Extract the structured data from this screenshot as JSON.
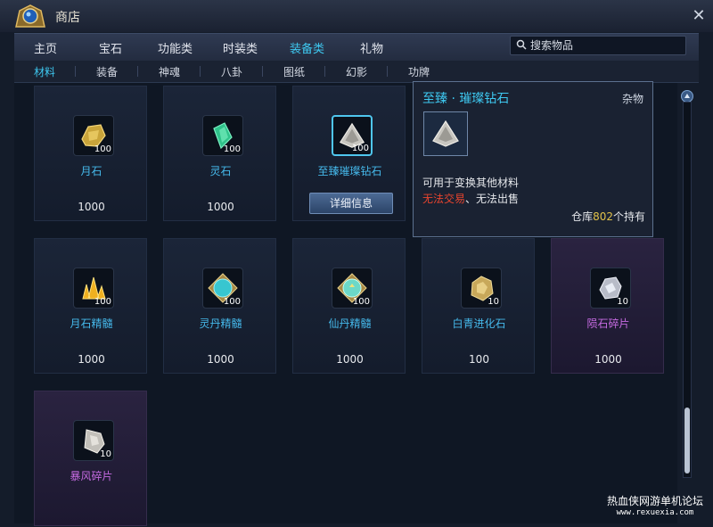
{
  "window": {
    "title": "商店"
  },
  "nav": {
    "tabs": [
      {
        "label": "主页"
      },
      {
        "label": "宝石"
      },
      {
        "label": "功能类"
      },
      {
        "label": "时装类"
      },
      {
        "label": "装备类"
      },
      {
        "label": "礼物"
      }
    ],
    "active_index": 4
  },
  "search": {
    "placeholder": "搜索物品"
  },
  "subnav": {
    "tabs": [
      {
        "label": "材料"
      },
      {
        "label": "装备"
      },
      {
        "label": "神魂"
      },
      {
        "label": "八卦"
      },
      {
        "label": "图纸"
      },
      {
        "label": "幻影"
      },
      {
        "label": "功牌"
      }
    ],
    "active_index": 0
  },
  "items": [
    {
      "name": "月石",
      "qty": "100",
      "price": "1000",
      "icon": "moonstone-icon"
    },
    {
      "name": "灵石",
      "qty": "100",
      "price": "1000",
      "icon": "spirit-stone-icon"
    },
    {
      "name": "至臻璀璨钻石",
      "qty": "100",
      "price": "",
      "icon": "diamond-icon",
      "detail_label": "详细信息"
    },
    {
      "name": "月石精髓",
      "qty": "100",
      "price": "1000",
      "icon": "moonstone-essence-icon"
    },
    {
      "name": "灵丹精髓",
      "qty": "100",
      "price": "1000",
      "icon": "elixir-essence-icon"
    },
    {
      "name": "仙丹精髓",
      "qty": "100",
      "price": "1000",
      "icon": "immortal-elixir-icon"
    },
    {
      "name": "白青进化石",
      "qty": "10",
      "price": "100",
      "icon": "evolution-stone-icon"
    },
    {
      "name": "陨石碎片",
      "qty": "10",
      "price": "1000",
      "icon": "meteorite-shard-icon"
    },
    {
      "name": "暴风碎片",
      "qty": "10",
      "price": "",
      "icon": "storm-shard-icon"
    }
  ],
  "tooltip": {
    "title": "至臻 · 璀璨钻石",
    "category": "杂物",
    "description": "可用于变换其他材料",
    "restriction": "无法交易",
    "sep": "、",
    "restriction2": "无法出售",
    "stock_prefix": "仓库",
    "stock_count": "802",
    "stock_suffix": "个持有"
  },
  "watermark": {
    "line1": "热血侠网游单机论坛",
    "line2": "www.rexuexia.com"
  },
  "colors": {
    "accent": "#3ec8f0",
    "purple_name": "#c56ae0",
    "restriction": "#e8442e",
    "stock_number": "#e2c24a"
  }
}
